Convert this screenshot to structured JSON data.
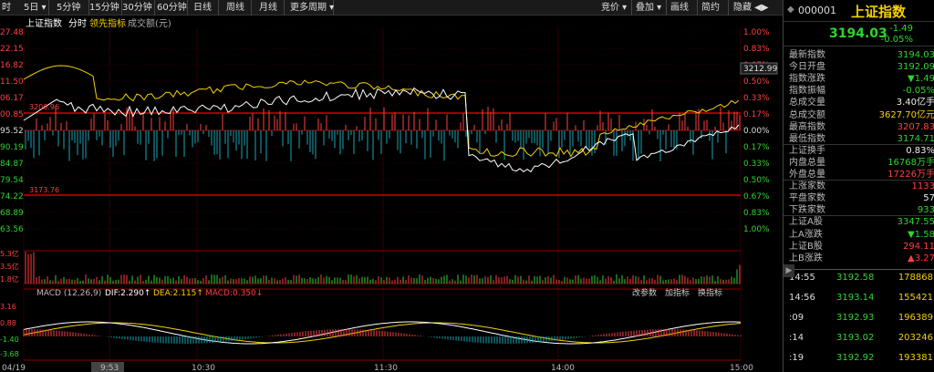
{
  "toolbar": {
    "items": [
      "时",
      "5日",
      "5分钟",
      "15分钟",
      "30分钟",
      "60分钟",
      "日线",
      "周线",
      "月线",
      "更多周期"
    ],
    "right": [
      "竞价",
      "叠加",
      "画线",
      "简约",
      "隐藏"
    ]
  },
  "chart_header": {
    "name": "上证指数",
    "tabs": [
      "分时",
      "领先指标",
      "成交额(元)"
    ]
  },
  "price_axis_left": [
    "27.48",
    "22.15",
    "16.82",
    "11.50",
    "06.17",
    "00.85",
    "95.52",
    "90.19",
    "84.87",
    "79.54",
    "74.22",
    "68.89",
    "63.56"
  ],
  "pct_axis_right": [
    "1.00%",
    "0.83%",
    "0.67%",
    "0.50%",
    "0.33%",
    "0.17%",
    "0.00%",
    "0.17%",
    "0.33%",
    "0.50%",
    "0.67%",
    "0.83%",
    "1.00%"
  ],
  "annotations": {
    "high": "3200.96",
    "low": "3173.76",
    "current": "3212.99"
  },
  "volume_axis": [
    "5.3亿",
    "3.5亿",
    "1.8亿"
  ],
  "macd_header": {
    "name": "MACD (12,26,9)",
    "dif": "DIF:2.290↑",
    "dea": "DEA:2.115↑",
    "macd": "MACD:0.350↓",
    "buttons": [
      "改参数",
      "加指标",
      "换指标"
    ]
  },
  "macd_axis": [
    "3.16",
    "0.88",
    "-1.40",
    "-3.68"
  ],
  "time_axis": [
    "04/19",
    "9:53",
    "10:30",
    "11:30",
    "14:00",
    "15:00"
  ],
  "quote": {
    "code": "000001",
    "name": "上证指数",
    "price": "3194.03",
    "change": "-1.49",
    "change_pct": "-0.05%",
    "fields": [
      {
        "label": "最新指数",
        "value": "3194.03",
        "color": "green"
      },
      {
        "label": "今日开盘",
        "value": "3192.09",
        "color": "green"
      },
      {
        "label": "指数涨跌",
        "value": "▼1.49",
        "color": "green"
      },
      {
        "label": "指数振幅",
        "value": "-0.05%",
        "color": "green"
      },
      {
        "label": "总成交量",
        "value": "3.40亿手",
        "color": "white"
      },
      {
        "label": "总成交额",
        "value": "3627.70亿元",
        "color": "yellow"
      },
      {
        "label": "最高指数",
        "value": "3207.83",
        "color": "red"
      },
      {
        "label": "最低指数",
        "value": "3174.71",
        "color": "green"
      },
      {
        "label": "上证换手",
        "value": "0.83%",
        "color": "white"
      },
      {
        "label": "内盘总量",
        "value": "16768万手",
        "color": "green"
      },
      {
        "label": "外盘总量",
        "value": "17226万手",
        "color": "red"
      },
      {
        "label": "上涨家数",
        "value": "1133",
        "color": "red"
      },
      {
        "label": "平盘家数",
        "value": "57",
        "color": "white"
      },
      {
        "label": "下跌家数",
        "value": "933",
        "color": "green"
      },
      {
        "label": "上证A股",
        "value": "3347.55",
        "color": "green"
      },
      {
        "label": "上A涨跌",
        "value": "▼1.58",
        "color": "green"
      },
      {
        "label": "上证B股",
        "value": "294.11",
        "color": "red"
      },
      {
        "label": "上B涨跌",
        "value": "▲3.27",
        "color": "red"
      }
    ],
    "ticks": [
      {
        "time": "14:55",
        "price": "3192.58",
        "vol": "178868"
      },
      {
        "time": "14:56",
        "price": "3193.14",
        "vol": "155421"
      },
      {
        "time": ":09",
        "price": "3192.93",
        "vol": "196389"
      },
      {
        "time": ":14",
        "price": "3193.02",
        "vol": "203246"
      },
      {
        "time": ":19",
        "price": "3192.92",
        "vol": "193381"
      }
    ]
  },
  "colors": {
    "up": "#ff4040",
    "down": "#2ed52e",
    "index_line": "#ffffff",
    "lead_line": "#f5d000",
    "dea": "#f5d000",
    "axis": "#8c0000"
  }
}
